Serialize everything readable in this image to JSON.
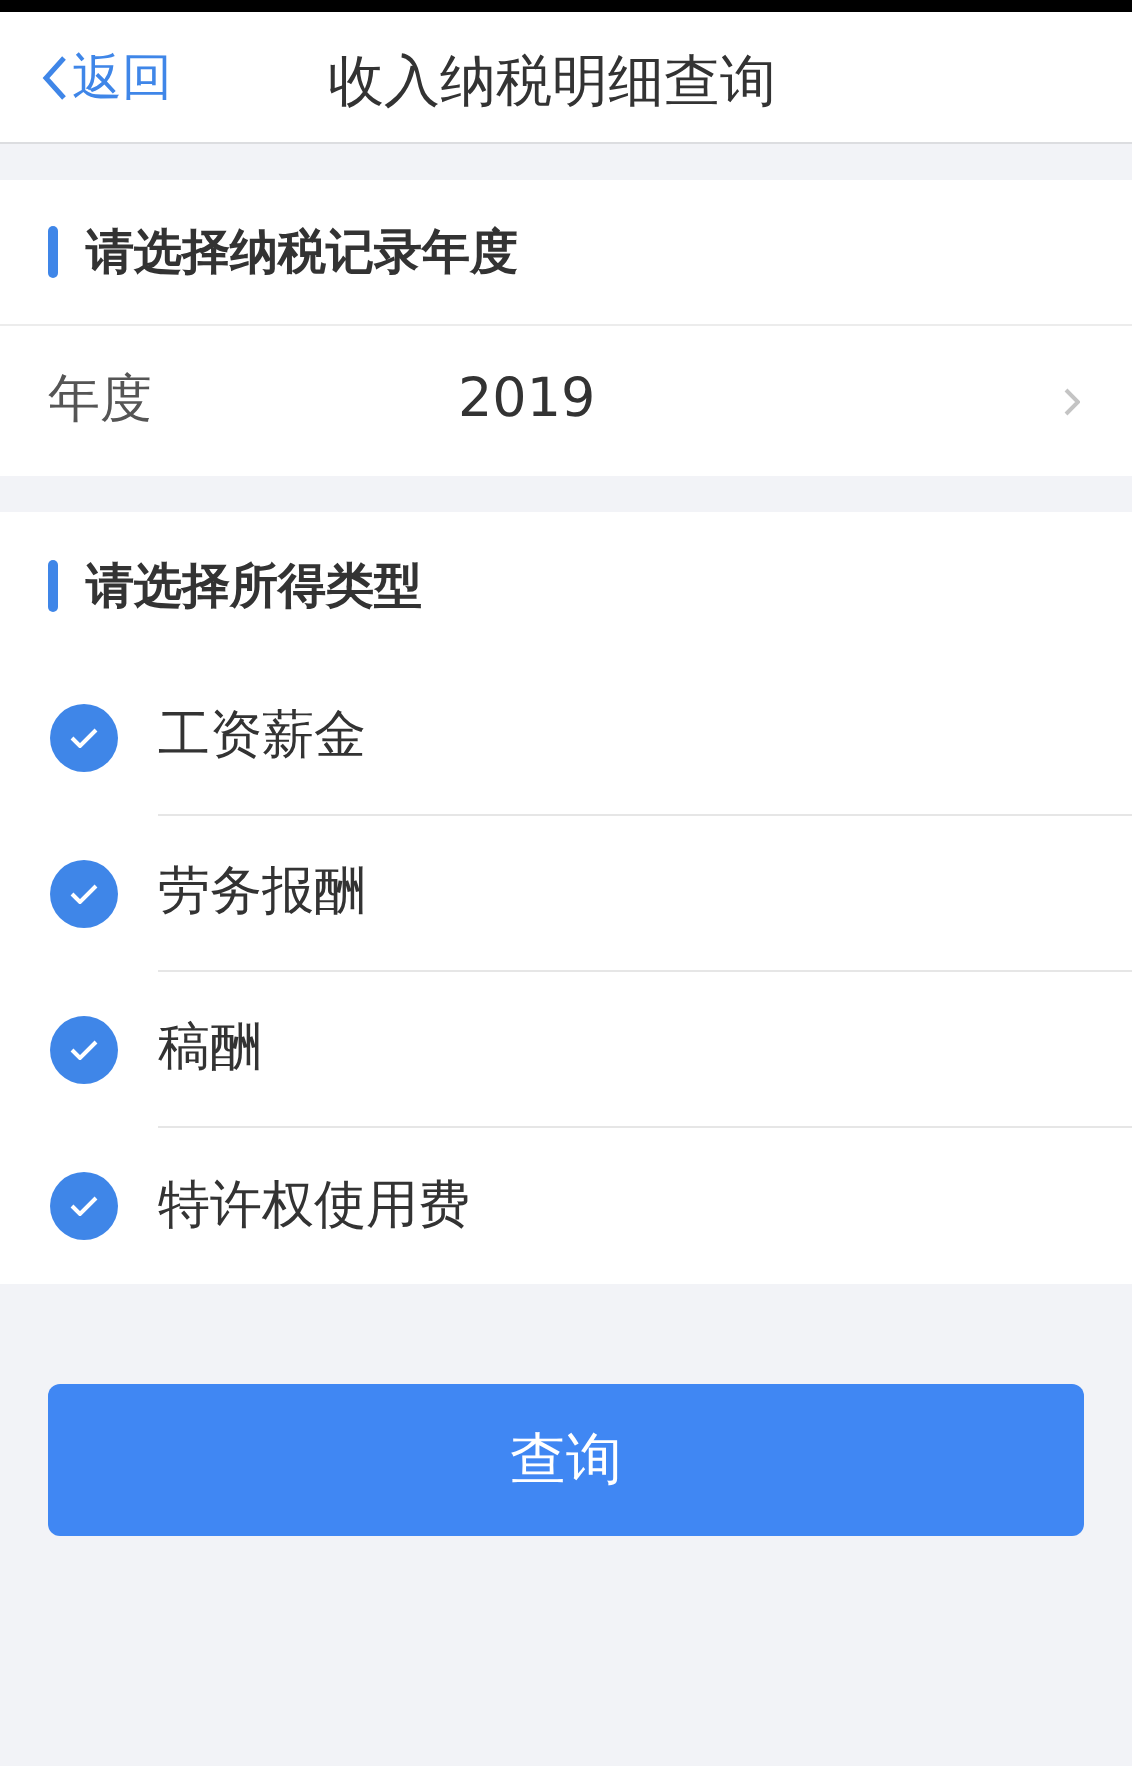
{
  "nav": {
    "back": "返回",
    "title": "收入纳税明细查询"
  },
  "year_section": {
    "title": "请选择纳税记录年度",
    "label": "年度",
    "value": "2019"
  },
  "type_section": {
    "title": "请选择所得类型",
    "options": [
      {
        "label": "工资薪金",
        "checked": true
      },
      {
        "label": "劳务报酬",
        "checked": true
      },
      {
        "label": "稿酬",
        "checked": true
      },
      {
        "label": "特许权使用费",
        "checked": true
      }
    ]
  },
  "query_button": "查询"
}
